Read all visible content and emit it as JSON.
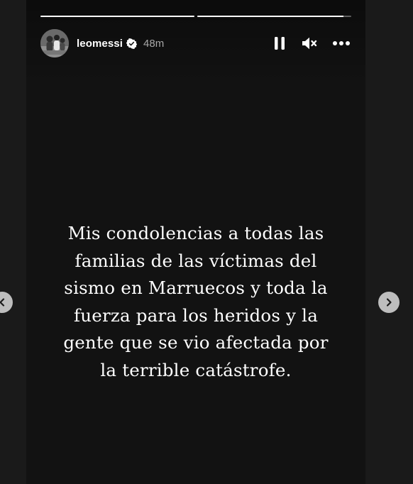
{
  "story": {
    "username": "leomessi",
    "time_ago": "48m",
    "progress": [
      1.0,
      0.95
    ],
    "caption_lines": [
      "Mis condolencias a todas las",
      "familias de las víctimas del",
      "sismo en Marruecos y toda la",
      "fuerza para los heridos y la",
      "gente que se vio afectada por",
      "la terrible catástrofe."
    ]
  },
  "icons": {
    "verified": "verified-badge-icon",
    "pause": "pause-icon",
    "mute": "muted-speaker-icon",
    "more": "more-options-icon",
    "prev": "chevron-left-icon",
    "next": "chevron-right-icon"
  },
  "colors": {
    "page_background": "#1a1a1a",
    "story_background": "#121212",
    "text": "#ffffff",
    "secondary_text": "#a8a8a8",
    "nav_button": "#bdbdbd"
  }
}
